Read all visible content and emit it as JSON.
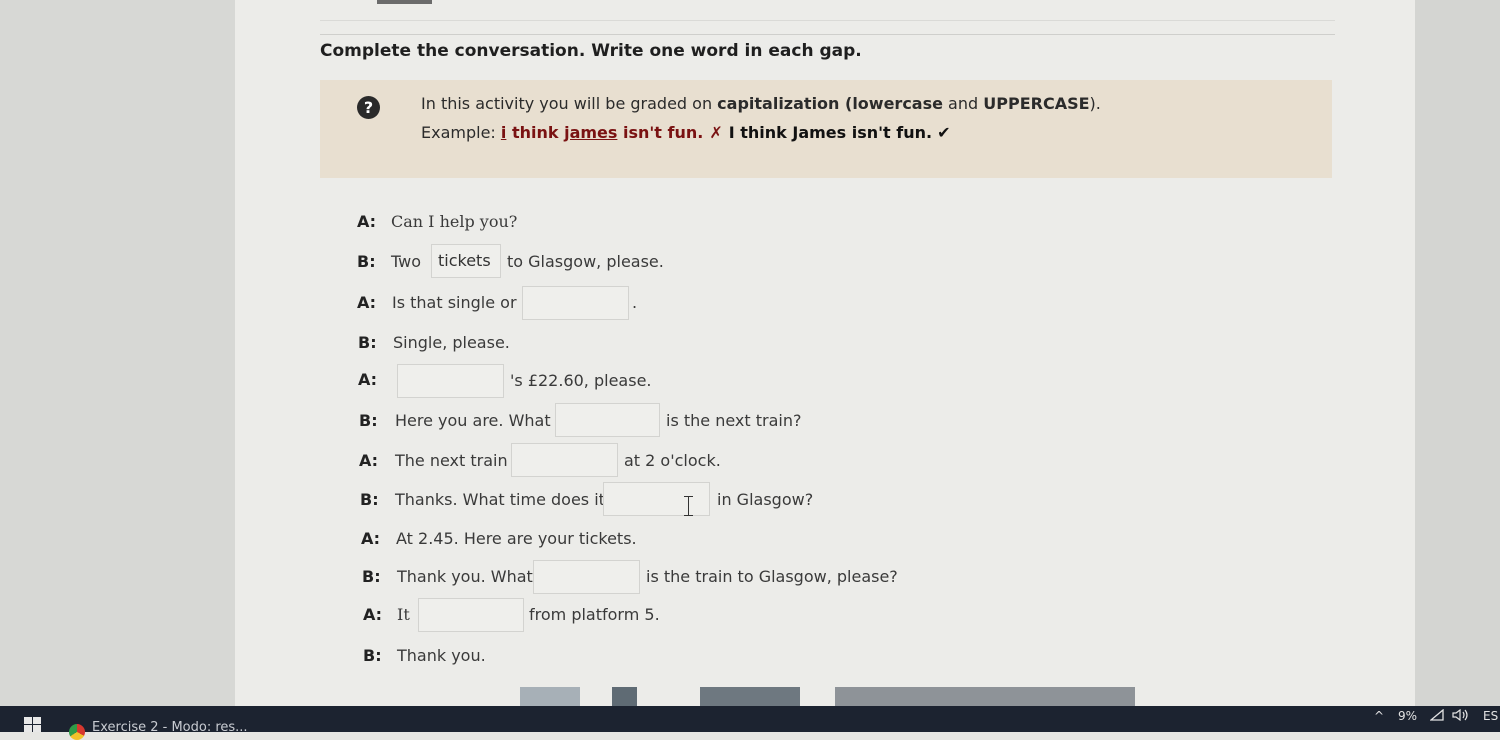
{
  "instruction": "Complete the conversation. Write one word in each gap.",
  "info_box": {
    "icon": "question-icon",
    "line1_prefix": "In this activity you will be graded on ",
    "line1_bold": "capitalization (lowercase",
    "line1_mid": " and ",
    "line1_bold2": "UPPERCASE",
    "line1_suffix": ").",
    "example_label": "Example: ",
    "example_wrong_a": "i",
    "example_wrong_b": " think ",
    "example_wrong_c": "james",
    "example_wrong_d": " isn't fun.",
    "wrong_mark": "✗",
    "example_right": "I think James isn't fun.",
    "right_mark": "✔"
  },
  "dialogue": [
    {
      "speaker": "A:",
      "text": "Can I help you?"
    },
    {
      "speaker": "B:",
      "before": "Two",
      "gap_value": "tickets",
      "after": "to Glasgow, please."
    },
    {
      "speaker": "A:",
      "before": "Is that single or",
      "gap_value": "",
      "after": "."
    },
    {
      "speaker": "B:",
      "text": "Single, please."
    },
    {
      "speaker": "A:",
      "gap_value": "",
      "after": "'s £22.60, please."
    },
    {
      "speaker": "B:",
      "before": "Here you are. What",
      "gap_value": "",
      "after": "is the next train?"
    },
    {
      "speaker": "A:",
      "before": "The next train",
      "gap_value": "",
      "after": "at 2 o'clock."
    },
    {
      "speaker": "B:",
      "before": "Thanks. What time does it",
      "gap_value": "",
      "after": "in Glasgow?"
    },
    {
      "speaker": "A:",
      "text": "At 2.45. Here are your tickets."
    },
    {
      "speaker": "B:",
      "before": "Thank you. What",
      "gap_value": "",
      "after": "is the train to Glasgow, please?"
    },
    {
      "speaker": "A:",
      "before": "It",
      "gap_value": "",
      "after": "from platform 5."
    },
    {
      "speaker": "B:",
      "text": "Thank you."
    }
  ],
  "taskbar": {
    "start_icon": "windows-icon",
    "app_icon": "chrome-icon",
    "app_label": "Exercise 2 - Modo: res...",
    "tray_chevron": "^",
    "tray_battery": "9%",
    "tray_wifi": "wifi-icon",
    "tray_volume": "volume-icon",
    "tray_lang": "ES"
  },
  "colors": {
    "info_bg": "#e8dfd0",
    "wrong": "#7a1212",
    "page_bg": "#ecece9",
    "taskbar": "#1c2330"
  }
}
